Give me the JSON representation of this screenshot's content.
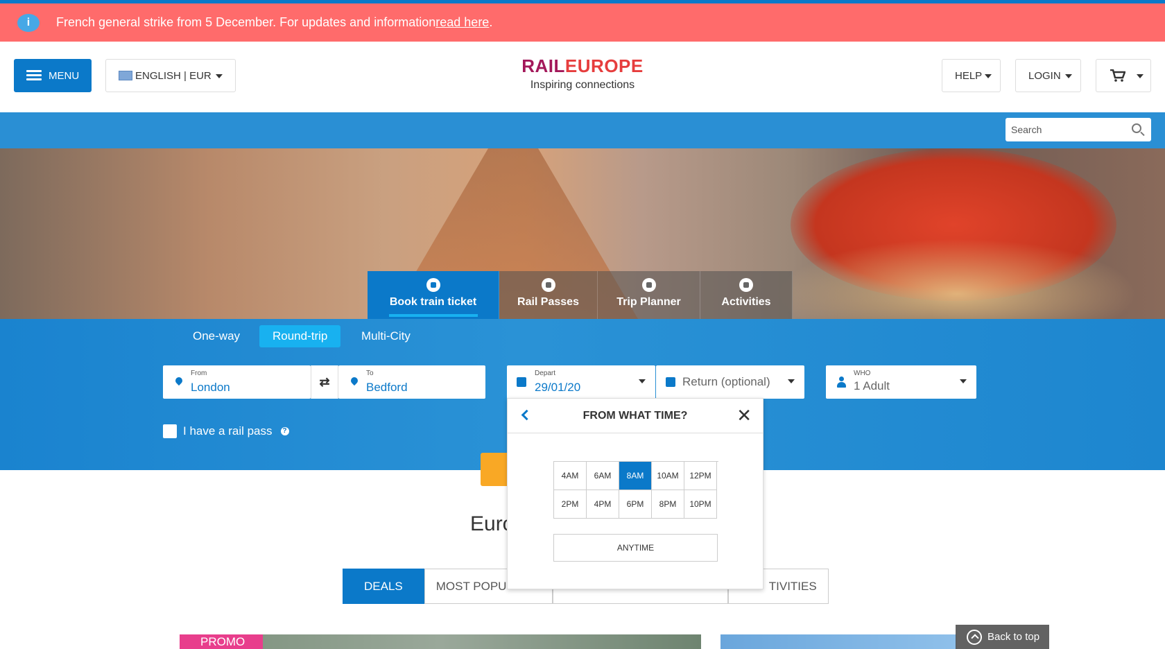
{
  "alert": {
    "text": "French general strike from 5 December. For updates and information ",
    "link": "read here",
    "after": ".",
    "icon": "info-icon"
  },
  "header": {
    "menu_label": "MENU",
    "language_label": "ENGLISH | EUR",
    "brand_part1": "RAIL",
    "brand_part2": "EUROPE",
    "tagline": "Inspiring connections",
    "help_label": "HELP",
    "login_label": "LOGIN",
    "cart_icon": "cart-icon"
  },
  "search": {
    "placeholder": "Search"
  },
  "booking_tabs": [
    {
      "label": "Book train ticket",
      "icon": "train-icon"
    },
    {
      "label": "Rail Passes",
      "icon": "pass-icon"
    },
    {
      "label": "Trip Planner",
      "icon": "calendar-icon"
    },
    {
      "label": "Activities",
      "icon": "ticket-icon"
    }
  ],
  "trip_types": [
    "One-way",
    "Round-trip",
    "Multi-City"
  ],
  "form": {
    "from_label": "From",
    "from_value": "London",
    "to_label": "To",
    "to_value": "Bedford",
    "depart_label": "Depart",
    "depart_value": "29/01/20",
    "return_placeholder": "Return (optional)",
    "who_label": "WHO",
    "who_value": "1 Adult",
    "railpass_label": "I have a rail pass",
    "railpass_help": "?"
  },
  "time_popup": {
    "title": "FROM WHAT TIME?",
    "times": [
      "4AM",
      "6AM",
      "8AM",
      "10AM",
      "12PM",
      "2PM",
      "4PM",
      "6PM",
      "8PM",
      "10PM"
    ],
    "selected": "8AM",
    "anytime_label": "ANYTIME"
  },
  "content": {
    "heading_partial": "Euro",
    "tabs": [
      {
        "label": "DEALS"
      },
      {
        "label": "MOST POPU"
      },
      {
        "label": ""
      },
      {
        "label": "TIVITIES"
      }
    ],
    "promo_label": "PROMO",
    "back_to_top": "Back to top"
  },
  "colors": {
    "primary": "#0b79c9",
    "alert": "#ff6b6b",
    "accent": "#18b1f0",
    "brand": "#a3185a",
    "search_button": "#f9a825",
    "promo": "#e83e8c"
  }
}
